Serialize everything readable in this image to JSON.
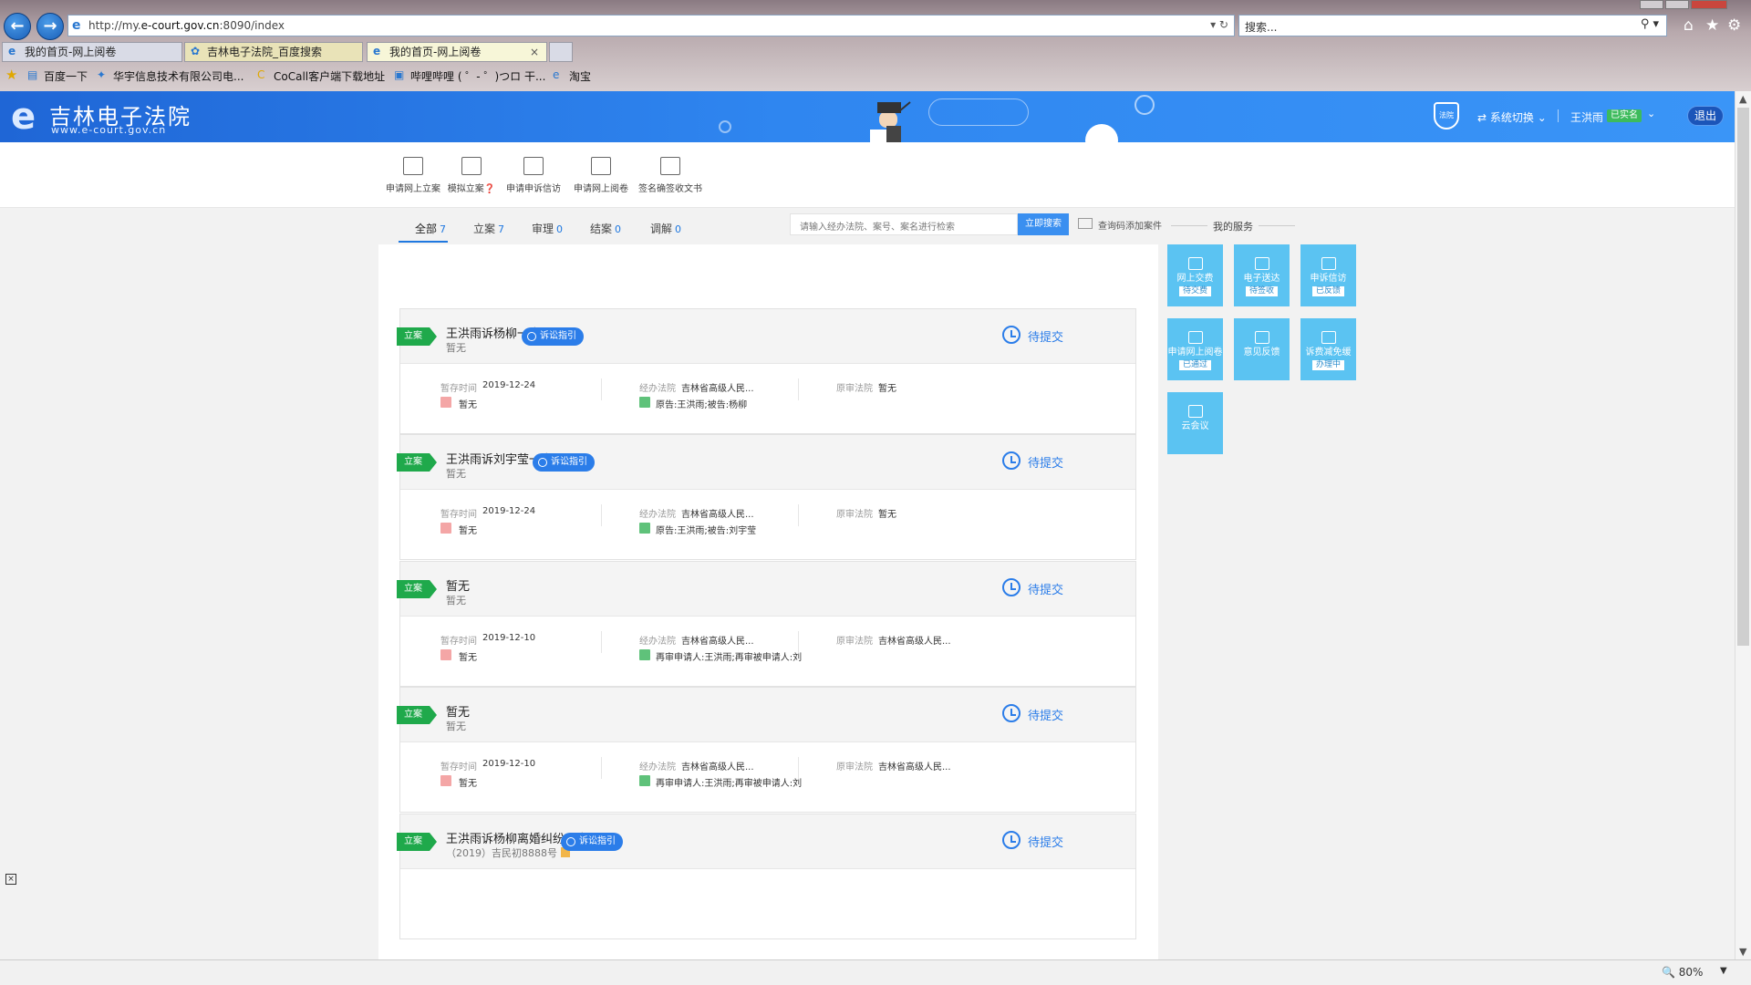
{
  "browser": {
    "url_prefix": "http://my.",
    "url_domain": "e-court.gov.cn",
    "url_suffix": ":8090/index",
    "search_placeholder": "搜索...",
    "tabs": [
      {
        "label": "我的首页-网上阅卷"
      },
      {
        "label": "吉林电子法院_百度搜索"
      },
      {
        "label": "我的首页-网上阅卷"
      }
    ],
    "favorites": [
      {
        "label": "百度一下"
      },
      {
        "label": "华宇信息技术有限公司电..."
      },
      {
        "label": "CoCall客户端下载地址"
      },
      {
        "label": "哔哩哔哩 ( ゜- ゜)つロ 干..."
      },
      {
        "label": "淘宝"
      }
    ],
    "zoom": "80%"
  },
  "header": {
    "logo_title": "吉林电子法院",
    "logo_subtitle": "www.e-court.gov.cn",
    "shield_text": "法院",
    "system_switch": "系统切换",
    "user_name": "王洪雨",
    "verified": "已实名",
    "logout": "退出"
  },
  "toolbar": [
    {
      "label": "申请网上立案"
    },
    {
      "label": "模拟立案❓"
    },
    {
      "label": "申请申诉信访"
    },
    {
      "label": "申请网上阅卷"
    },
    {
      "label": "签名确签收文书"
    }
  ],
  "filter_tabs": [
    {
      "label": "全部",
      "count": "7"
    },
    {
      "label": "立案",
      "count": "7"
    },
    {
      "label": "审理",
      "count": "0"
    },
    {
      "label": "结案",
      "count": "0"
    },
    {
      "label": "调解",
      "count": "0"
    }
  ],
  "search": {
    "placeholder": "请输入经办法院、案号、案名进行检索",
    "button": "立即搜索",
    "query_add": "查询码添加案件"
  },
  "my_services_title": "我的服务",
  "labels": {
    "saved_time": "暂存时间",
    "handling_court": "经办法院",
    "original_court": "原审法院",
    "guide": "诉讼指引",
    "pending": "待提交",
    "flag": "立案"
  },
  "cases": [
    {
      "title": "王洪雨诉杨柳一案",
      "sub": "暂无",
      "time": "2019-12-24",
      "note": "暂无",
      "court": "吉林省高级人民...",
      "parties": "原告:王洪雨;被告:杨柳",
      "orig": "暂无",
      "has_guide": true
    },
    {
      "title": "王洪雨诉刘宇莹一案",
      "sub": "暂无",
      "time": "2019-12-24",
      "note": "暂无",
      "court": "吉林省高级人民...",
      "parties": "原告:王洪雨;被告:刘宇莹",
      "orig": "暂无",
      "has_guide": true
    },
    {
      "title": "暂无",
      "sub": "暂无",
      "time": "2019-12-10",
      "note": "暂无",
      "court": "吉林省高级人民...",
      "parties": "再审申请人:王洪雨;再审被申请人:刘",
      "orig": "吉林省高级人民...",
      "has_guide": false
    },
    {
      "title": "暂无",
      "sub": "暂无",
      "time": "2019-12-10",
      "note": "暂无",
      "court": "吉林省高级人民...",
      "parties": "再审申请人:王洪雨;再审被申请人:刘",
      "orig": "吉林省高级人民...",
      "has_guide": false
    },
    {
      "title": "王洪雨诉杨柳离婚纠纷一案",
      "sub": "（2019）吉民初8888号",
      "time": "",
      "note": "",
      "court": "",
      "parties": "",
      "orig": "",
      "has_guide": true
    }
  ],
  "services": [
    {
      "name": "网上交费",
      "badge": "待交费"
    },
    {
      "name": "电子送达",
      "badge": "待签收"
    },
    {
      "name": "申诉信访",
      "badge": "已反馈"
    },
    {
      "name": "申请网上阅卷",
      "badge": "已通过"
    },
    {
      "name": "意见反馈",
      "badge": ""
    },
    {
      "name": "诉费减免缓",
      "badge": "办理中"
    },
    {
      "name": "云会议",
      "badge": ""
    }
  ]
}
